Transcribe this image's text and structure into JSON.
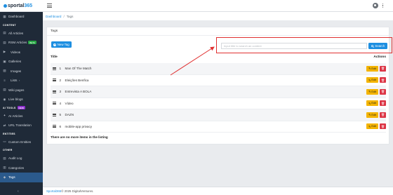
{
  "brand": {
    "part1": "sportal",
    "part2": "365"
  },
  "sidebar": {
    "items": [
      {
        "type": "item",
        "label": "Dashboard",
        "icon": "dashboard-icon"
      },
      {
        "type": "section",
        "label": "CONTENT"
      },
      {
        "type": "item",
        "label": "All Articles",
        "icon": "articles-icon"
      },
      {
        "type": "item",
        "label": "RSM Articles",
        "icon": "rsm-icon",
        "badge": "BETA",
        "badge_color": "#28a745"
      },
      {
        "type": "item",
        "label": "Videos",
        "icon": "video-icon",
        "chevron": true
      },
      {
        "type": "item",
        "label": "Galleries",
        "icon": "gallery-icon"
      },
      {
        "type": "item",
        "label": "Images",
        "icon": "image-icon",
        "chevron": true
      },
      {
        "type": "item",
        "label": "Lists",
        "icon": "list-icon",
        "chevron": true
      },
      {
        "type": "item",
        "label": "Wiki pages",
        "icon": "wiki-icon"
      },
      {
        "type": "item",
        "label": "Live blogs",
        "icon": "blog-icon"
      },
      {
        "type": "section",
        "label": "AI TOOLS",
        "badge": "NEW",
        "badge_color": "#8f2fd1"
      },
      {
        "type": "item",
        "label": "AI Articles",
        "icon": "ai-icon"
      },
      {
        "type": "item",
        "label": "URL Translation",
        "icon": "translate-icon"
      },
      {
        "type": "section",
        "label": "ENTITIES"
      },
      {
        "type": "item",
        "label": "Custom Entities",
        "icon": "entities-icon"
      },
      {
        "type": "section",
        "label": "OTHER"
      },
      {
        "type": "item",
        "label": "Audit Log",
        "icon": "audit-icon"
      },
      {
        "type": "item",
        "label": "Categories",
        "icon": "categories-icon"
      },
      {
        "type": "item",
        "label": "Tags",
        "icon": "tag-icon",
        "active": true
      }
    ]
  },
  "breadcrumb": {
    "home": "Dashboard",
    "current": "Tags"
  },
  "card": {
    "title": "Tags"
  },
  "toolbar": {
    "new_label": "New Tag",
    "search_placeholder": "Input title to search an content",
    "search_label": "Search"
  },
  "table": {
    "col_title": "Title",
    "col_actions": "Actions",
    "edit_label": "Edit",
    "rows": [
      {
        "num": "1",
        "title": "Man Of The Match"
      },
      {
        "num": "2",
        "title": "Eleições Benfica"
      },
      {
        "num": "3",
        "title": "Entrevista A BOLA"
      },
      {
        "num": "4",
        "title": "Vídeo"
      },
      {
        "num": "5",
        "title": "DAZN"
      },
      {
        "num": "6",
        "title": "mobile-app privacy"
      }
    ],
    "empty_note": "There are no more items in the listing"
  },
  "footer": {
    "link": "Sportal365",
    "text": " © 2025 DigitalVentures."
  },
  "colors": {
    "primary": "#1e8fe1",
    "sidebar": "#1f2a38",
    "edit": "#f4b400",
    "delete": "#dc3545",
    "highlight": "#e03030"
  }
}
